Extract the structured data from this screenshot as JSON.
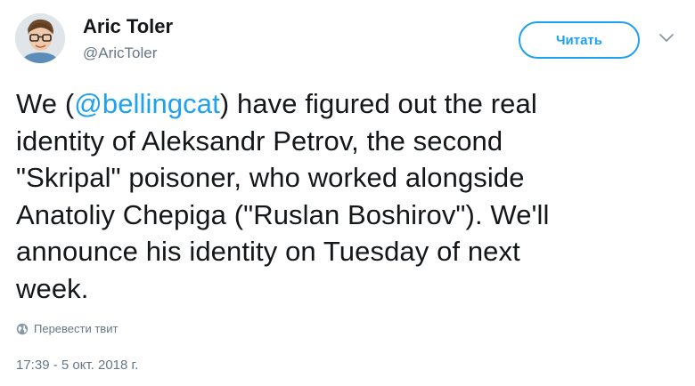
{
  "author": {
    "name": "Aric Toler",
    "handle": "@AricToler"
  },
  "follow_button": {
    "label": "Читать"
  },
  "tweet": {
    "line1": {
      "before": "We (",
      "mention": "@bellingcat",
      "after": ") have figured out the real"
    },
    "line2": "identity of Aleksandr Petrov, the second",
    "line3": "\"Skripal\" poisoner, who worked alongside",
    "line4": "Anatoliy Chepiga (\"Ruslan Boshirov\"). We'll",
    "line5": "announce his identity on Tuesday of next",
    "line6": "week."
  },
  "translate": {
    "label": "Перевести твит",
    "icon": "globe-icon"
  },
  "timestamp": "17:39 - 5 окт. 2018 г.",
  "colors": {
    "accent": "#1da1f2",
    "text": "#14171a",
    "secondary": "#657786"
  }
}
